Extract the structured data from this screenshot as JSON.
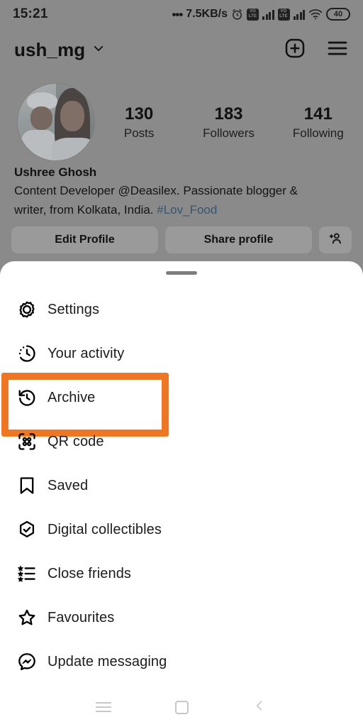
{
  "status_bar": {
    "time": "15:21",
    "network_dots": "•••",
    "network_speed": "7.5KB/s",
    "alarm_icon": "alarm-clock-icon",
    "sim1_label_top": "VO",
    "sim1_label_bottom": "LTE",
    "sim2_label_top": "VO",
    "sim2_label_bottom": "LTE",
    "wifi_icon": "wifi-icon",
    "battery_percent": "40"
  },
  "header": {
    "username": "ush_mg",
    "chevron_icon": "chevron-down-icon",
    "new_post_icon": "plus-square-icon",
    "menu_icon": "hamburger-menu-icon"
  },
  "profile": {
    "avatar_alt": "profile-photo",
    "stats": [
      {
        "value": "130",
        "label": "Posts"
      },
      {
        "value": "183",
        "label": "Followers"
      },
      {
        "value": "141",
        "label": "Following"
      }
    ],
    "full_name": "Ushree Ghosh",
    "bio_line1": "Content Developer @Deasilex. Passionate blogger &",
    "bio_line2": "writer, from Kolkata, India. ",
    "bio_hashtag": "#Lov_Food",
    "buttons": {
      "edit_profile": "Edit Profile",
      "share_profile": "Share profile",
      "add_person_icon": "add-person-icon"
    }
  },
  "sheet": {
    "drag_handle": "drag-handle",
    "highlighted_item": "Archive",
    "highlight_color": "#ef7622",
    "items": [
      {
        "label": "Settings",
        "icon": "gear-icon"
      },
      {
        "label": "Your activity",
        "icon": "activity-clock-icon"
      },
      {
        "label": "Archive",
        "icon": "archive-clock-icon"
      },
      {
        "label": "QR code",
        "icon": "qr-code-icon"
      },
      {
        "label": "Saved",
        "icon": "bookmark-icon"
      },
      {
        "label": "Digital collectibles",
        "icon": "hexagon-check-icon"
      },
      {
        "label": "Close friends",
        "icon": "star-list-icon"
      },
      {
        "label": "Favourites",
        "icon": "star-icon"
      },
      {
        "label": "Update messaging",
        "icon": "messenger-icon"
      }
    ]
  },
  "nav_bar": {
    "recents_icon": "recents-icon",
    "home_icon": "home-square-icon",
    "back_icon": "back-chevron-icon"
  }
}
